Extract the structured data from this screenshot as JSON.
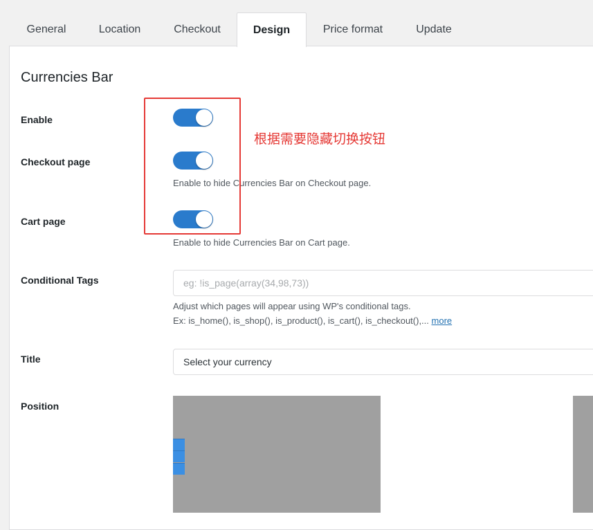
{
  "tabs": [
    {
      "label": "General"
    },
    {
      "label": "Location"
    },
    {
      "label": "Checkout"
    },
    {
      "label": "Design"
    },
    {
      "label": "Price format"
    },
    {
      "label": "Update"
    }
  ],
  "active_tab": "Design",
  "section_title": "Currencies Bar",
  "annotation_note": "根据需要隐藏切换按钮",
  "fields": {
    "enable": {
      "label": "Enable",
      "toggle_on": true
    },
    "checkout_page": {
      "label": "Checkout page",
      "toggle_on": true,
      "description": "Enable to hide Currencies Bar on Checkout page."
    },
    "cart_page": {
      "label": "Cart page",
      "toggle_on": true,
      "description": "Enable to hide Currencies Bar on Cart page."
    },
    "conditional_tags": {
      "label": "Conditional Tags",
      "placeholder": "eg: !is_page(array(34,98,73))",
      "value": "",
      "description_line1": "Adjust which pages will appear using WP's conditional tags.",
      "description_line2": "Ex: is_home(), is_shop(), is_product(), is_cart(), is_checkout(),...",
      "more_link": "more"
    },
    "title": {
      "label": "Title",
      "value": "Select your currency"
    },
    "position": {
      "label": "Position"
    }
  },
  "colors": {
    "toggle_on": "#2a7bcc",
    "annotation": "#e53935",
    "preview_bg": "#a0a0a0",
    "preview_block": "#3b8fe3"
  }
}
